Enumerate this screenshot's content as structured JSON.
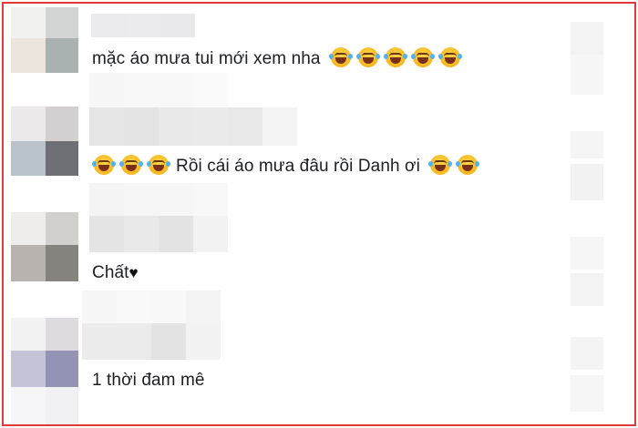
{
  "comments": [
    {
      "text": "mặc áo mưa tui mới xem nha",
      "emoji_before": 0,
      "emoji_after": 5,
      "emoji_name": "face-with-tears-of-joy-icon"
    },
    {
      "text": "Rồi cái áo mưa đâu rồi Danh ơi",
      "emoji_before": 3,
      "emoji_after": 2,
      "emoji_name": "face-with-tears-of-joy-icon"
    },
    {
      "text": "Chất",
      "suffix_icon": "black-heart-icon",
      "suffix_glyph": "♥"
    },
    {
      "text": "1 thời đam mê"
    }
  ],
  "colors": {
    "border": "#e2393b",
    "text": "#1c1e21"
  }
}
